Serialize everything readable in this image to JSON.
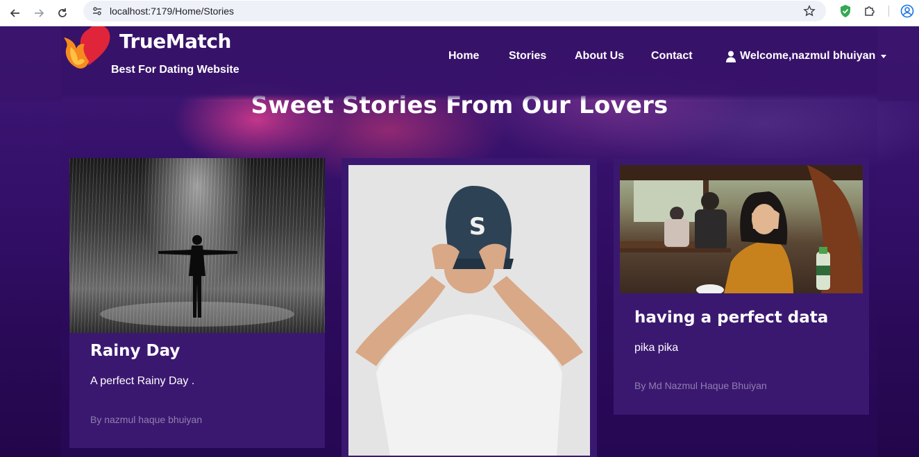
{
  "browser": {
    "url": "localhost:7179/Home/Stories"
  },
  "site": {
    "brand": "TrueMatch",
    "tagline": "Best For Dating Website",
    "nav": [
      {
        "label": "Home"
      },
      {
        "label": "Stories"
      },
      {
        "label": "About Us"
      },
      {
        "label": "Contact"
      }
    ],
    "user_greeting": "Welcome,nazmul bhuiyan"
  },
  "section": {
    "title": "Sweet Stories From Our Lovers"
  },
  "stories": [
    {
      "title": "Rainy Day",
      "text": "A perfect Rainy Day .",
      "author": "By nazmul haque bhuiyan"
    },
    {
      "title": "",
      "text": "",
      "author": ""
    },
    {
      "title": "having a perfect data",
      "text": "pika pika",
      "author": "By Md Nazmul Haque Bhuiyan"
    }
  ],
  "colors": {
    "card_bg": "#3b1870",
    "author_text": "#8e7fb0",
    "page_bg": "#2a0a55"
  }
}
